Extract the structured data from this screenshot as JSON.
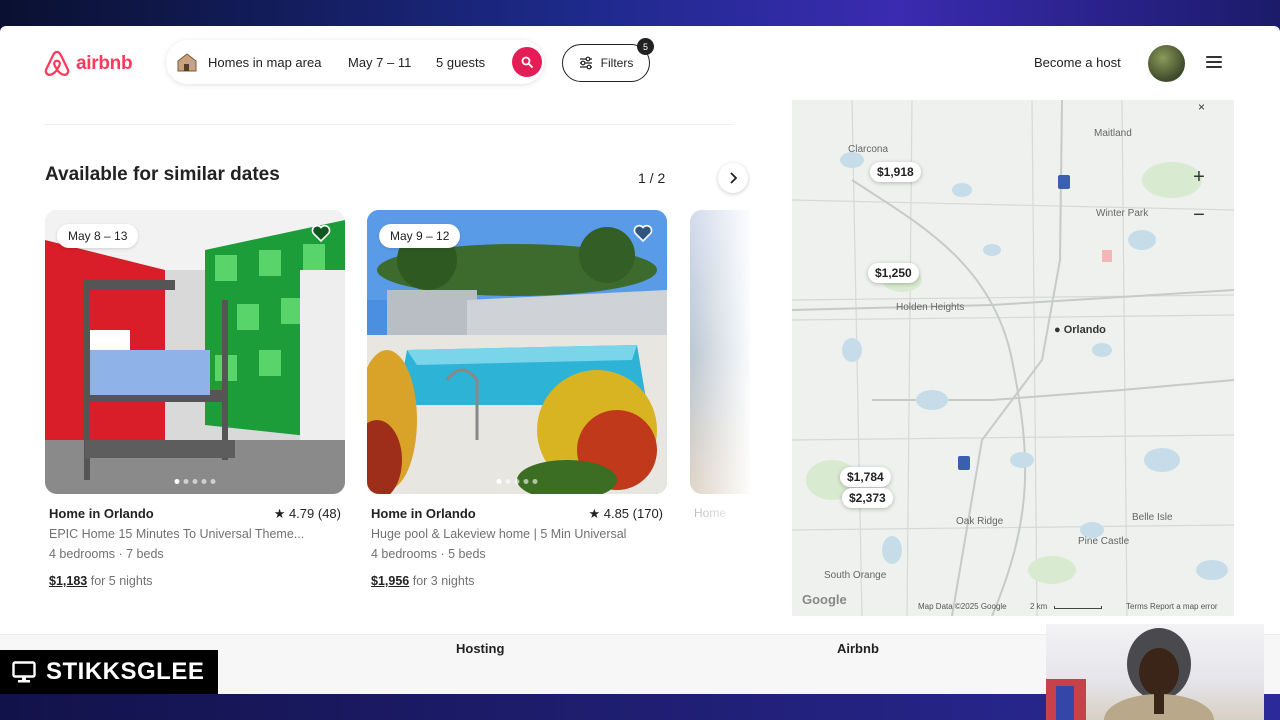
{
  "brand": {
    "logo_text": "airbnb",
    "accent": "#ff385c"
  },
  "search": {
    "where": "Homes in map area",
    "dates": "May 7 – 11",
    "guests": "5 guests",
    "filters_label": "Filters",
    "filters_count": "5"
  },
  "header": {
    "become_host": "Become a host"
  },
  "section": {
    "title": "Available for similar dates",
    "pager": "1 / 2"
  },
  "listings": [
    {
      "date_badge": "May 8 – 13",
      "type": "Home in Orlando",
      "rating": "★ 4.79 (48)",
      "description": "EPIC Home 15 Minutes To Universal Theme...",
      "beds": "4 bedrooms · 7 beds",
      "price": "$1,183",
      "price_suffix": "for 5 nights"
    },
    {
      "date_badge": "May 9 – 12",
      "type": "Home in Orlando",
      "rating": "★ 4.85 (170)",
      "description": "Huge pool & Lakeview home | 5 Min Universal",
      "beds": "4 bedrooms · 5 beds",
      "price": "$1,956",
      "price_suffix": "for 3 nights"
    },
    {
      "type": "Home"
    }
  ],
  "map": {
    "pins": [
      "$1,918",
      "$1,250",
      "$1,784",
      "$2,373"
    ],
    "city": "Orlando",
    "labels": [
      "Clarcona",
      "Maitland",
      "Winter Park",
      "Holden Heights",
      "Pine Castle",
      "Oak Ridge",
      "Belle Isle",
      "South Orange"
    ],
    "zoom_in": "+",
    "zoom_out": "−",
    "close": "×",
    "footer": {
      "data": "Map Data ©2025 Google",
      "scale": "2 km",
      "terms": "Terms",
      "report": "Report a map error",
      "brand": "Google"
    }
  },
  "footer": {
    "hosting": "Hosting",
    "airbnb": "Airbnb"
  },
  "overlay": {
    "streamer": "STIKKSGLEE"
  }
}
